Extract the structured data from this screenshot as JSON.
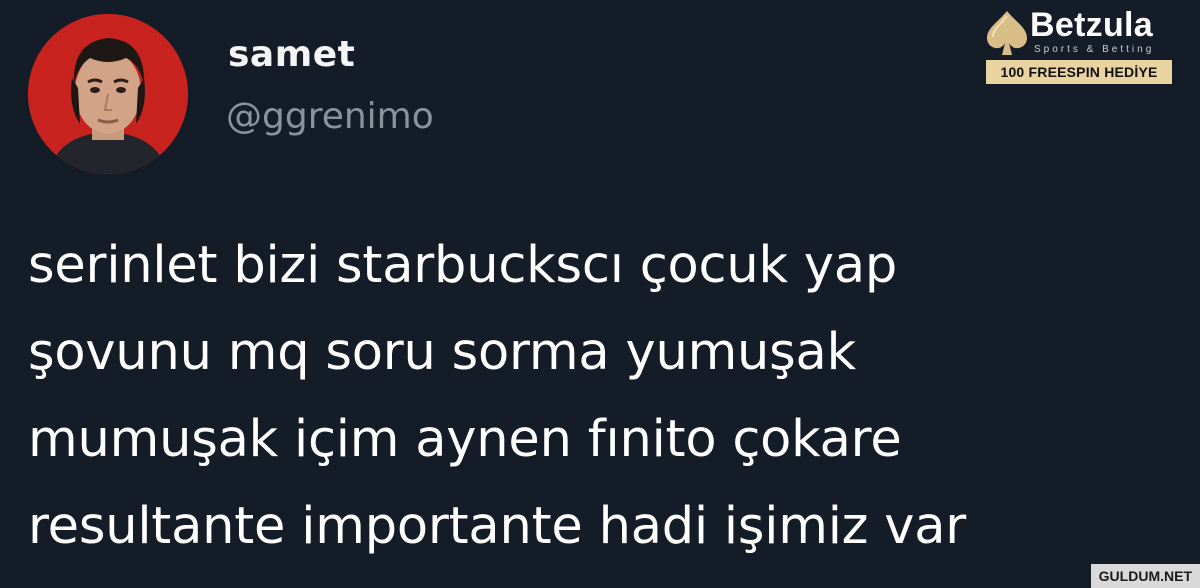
{
  "tweet": {
    "author": {
      "display_name": "samet",
      "handle": "@ggrenimo"
    },
    "text_lines": [
      "serinlet bizi starbuckscı çocuk yap",
      "şovunu mq soru sorma yumuşak",
      "mumuşak içim aynen fınito çokare",
      "resultante importante hadi işimiz var"
    ]
  },
  "brand_badge": {
    "name": "Betzula",
    "tagline": "Sports & Betting",
    "promo": "100 FREESPIN HEDİYE",
    "icon": "spade-icon",
    "accent_color": "#e8d3a1"
  },
  "watermark": {
    "text": "GULDUM.NET"
  },
  "colors": {
    "background": "#141c28",
    "avatar_background": "#c8231f",
    "handle": "#8a929c"
  }
}
